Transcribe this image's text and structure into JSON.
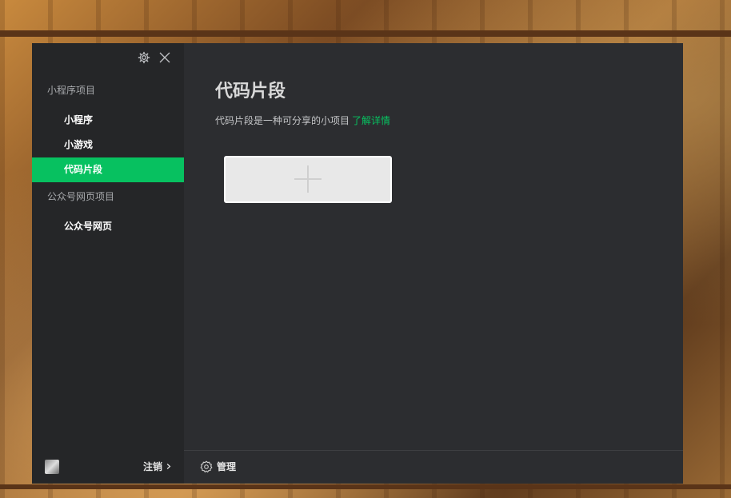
{
  "sidebar": {
    "groups": [
      {
        "title": "小程序项目",
        "items": [
          "小程序",
          "小游戏",
          "代码片段"
        ]
      },
      {
        "title": "公众号网页项目",
        "items": [
          "公众号网页"
        ]
      }
    ],
    "active_item": "代码片段",
    "logout_label": "注销"
  },
  "main": {
    "title": "代码片段",
    "description": "代码片段是一种可分享的小项目",
    "learn_more": "了解详情",
    "manage_label": "管理"
  },
  "colors": {
    "accent": "#07c160",
    "window_bg": "#2c2d30",
    "sidebar_bg": "#252628"
  },
  "icons": [
    "gear-icon",
    "close-icon",
    "plus-icon",
    "chevron-right-icon",
    "settings-icon"
  ]
}
